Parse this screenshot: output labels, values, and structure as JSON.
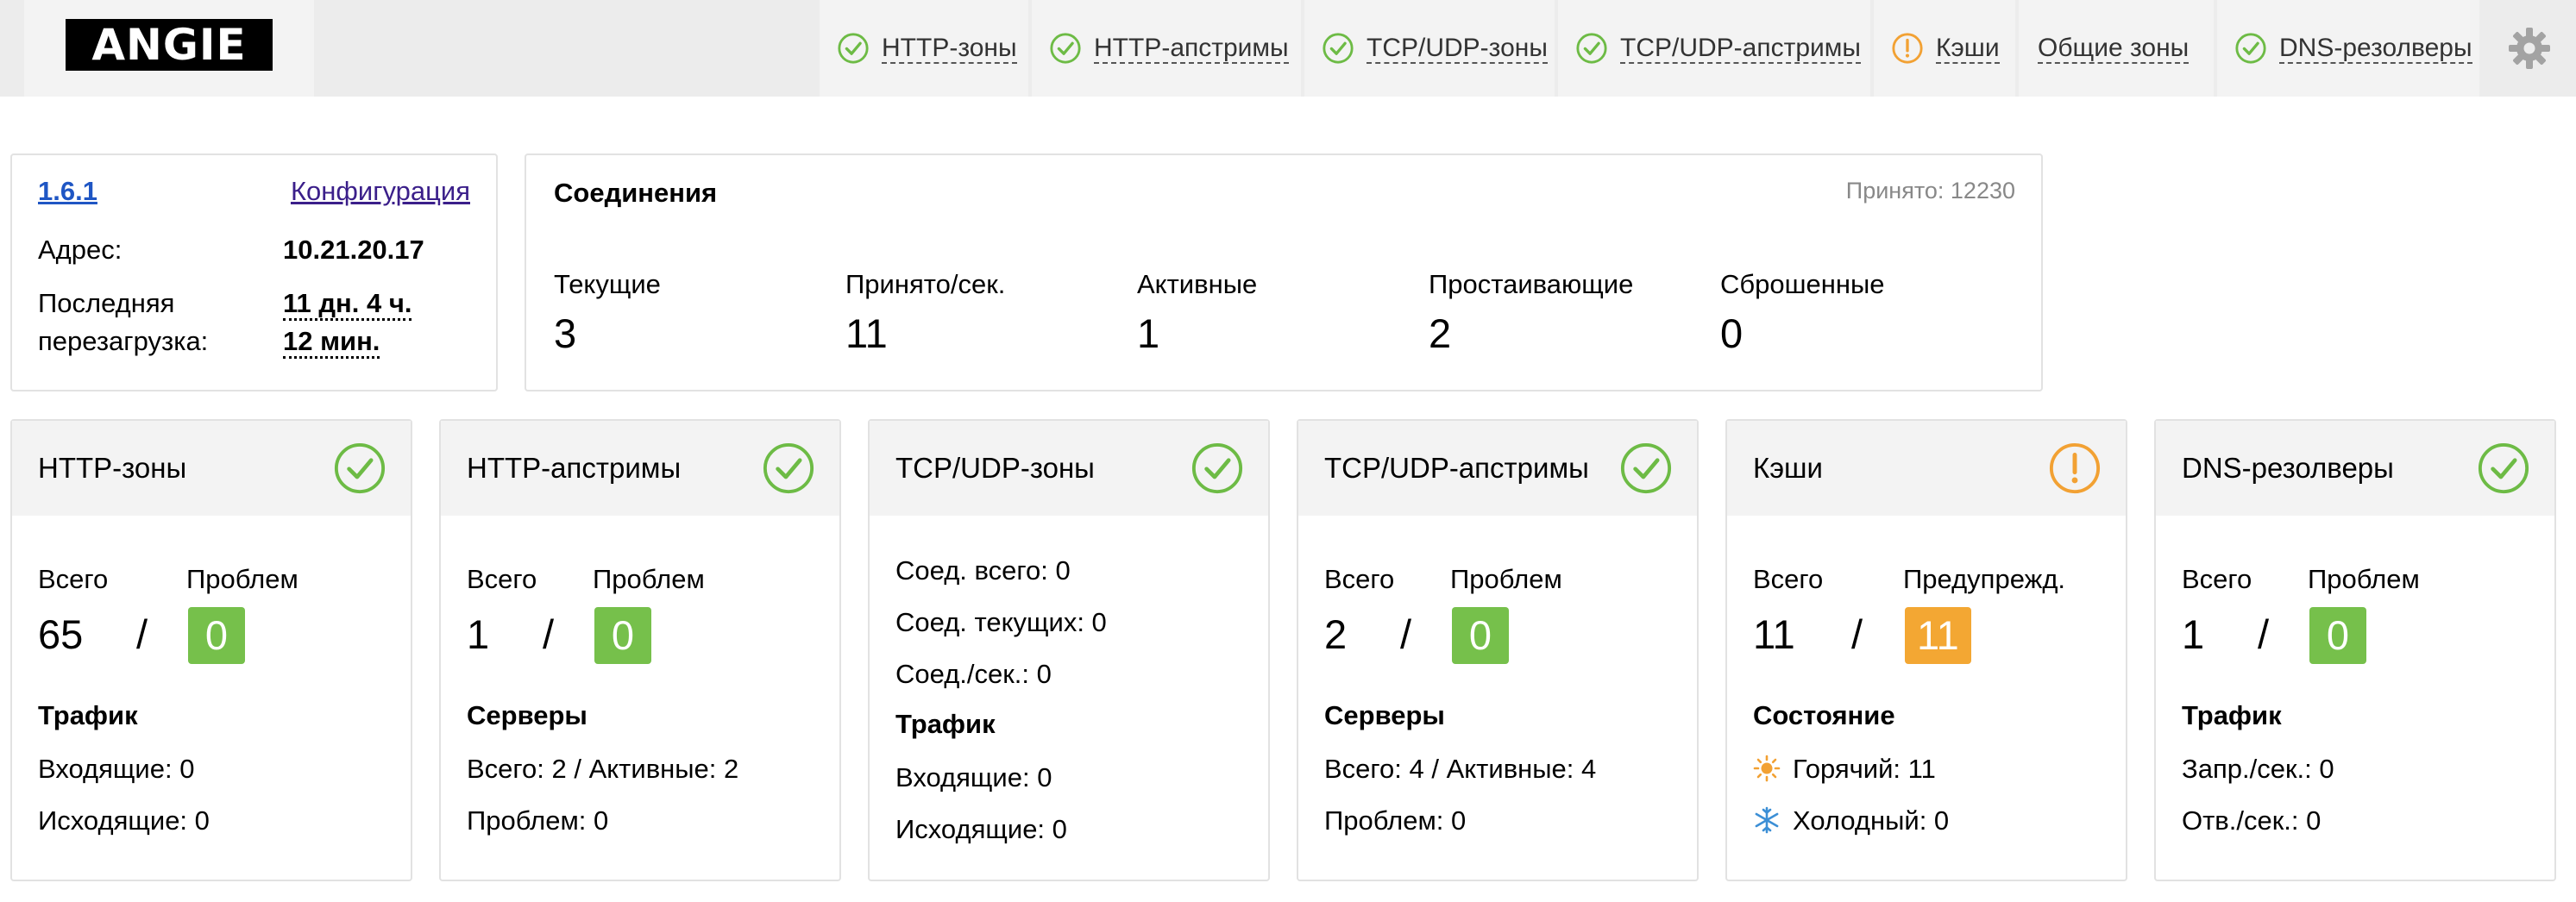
{
  "header": {
    "logo": "ANGIE",
    "tabs": [
      {
        "label": "HTTP-зоны",
        "status": "ok"
      },
      {
        "label": "HTTP-апстримы",
        "status": "ok"
      },
      {
        "label": "TCP/UDP-зоны",
        "status": "ok"
      },
      {
        "label": "TCP/UDP-апстримы",
        "status": "ok"
      },
      {
        "label": "Кэши",
        "status": "warning"
      },
      {
        "label": "Общие зоны",
        "status": "none"
      },
      {
        "label": "DNS-резолверы",
        "status": "ok"
      }
    ]
  },
  "colors": {
    "ok": "#6dbb45",
    "warning": "#f2a133",
    "badge_green": "#76c04b",
    "badge_orange": "#f3a733"
  },
  "info": {
    "version": "1.6.1",
    "config_link": "Конфигурация",
    "address_label": "Адрес:",
    "address": "10.21.20.17",
    "reload_label_1": "Последняя",
    "reload_label_2": "перезагрузка:",
    "reload_value_1": "11 дн. 4 ч.",
    "reload_value_2": "12 мин."
  },
  "connections": {
    "title": "Соединения",
    "accepted_total": "Принято: 12230",
    "items": [
      {
        "label": "Текущие",
        "value": "3"
      },
      {
        "label": "Принято/сек.",
        "value": "11"
      },
      {
        "label": "Активные",
        "value": "1"
      },
      {
        "label": "Простаивающие",
        "value": "2"
      },
      {
        "label": "Сброшенные",
        "value": "0"
      }
    ]
  },
  "cards": {
    "http_zones": {
      "title": "HTTP-зоны",
      "status": "ok",
      "total_label": "Всего",
      "total": "65",
      "sep": "/",
      "problem_label": "Проблем",
      "problem": "0",
      "section": "Трафик",
      "lines": [
        "Входящие: 0",
        "Исходящие: 0"
      ]
    },
    "http_upstreams": {
      "title": "HTTP-апстримы",
      "status": "ok",
      "total_label": "Всего",
      "total": "1",
      "sep": "/",
      "problem_label": "Проблем",
      "problem": "0",
      "section": "Серверы",
      "lines": [
        "Всего: 2 / Активные: 2",
        "Проблем: 0"
      ]
    },
    "tcp_zones": {
      "title": "TCP/UDP-зоны",
      "status": "ok",
      "lines": [
        "Соед. всего: 0",
        "Соед. текущих: 0",
        "Соед./сек.: 0"
      ],
      "section": "Трафик",
      "traffic": [
        "Входящие: 0",
        "Исходящие: 0"
      ]
    },
    "tcp_upstreams": {
      "title": "TCP/UDP-апстримы",
      "status": "ok",
      "total_label": "Всего",
      "total": "2",
      "sep": "/",
      "problem_label": "Проблем",
      "problem": "0",
      "section": "Серверы",
      "lines": [
        "Всего: 4 / Активные: 4",
        "Проблем: 0"
      ]
    },
    "caches": {
      "title": "Кэши",
      "status": "warning",
      "total_label": "Всего",
      "total": "11",
      "sep": "/",
      "problem_label": "Предупрежд.",
      "problem": "11",
      "section": "Состояние",
      "lines": [
        {
          "icon": "sun-icon",
          "text": "Горячий: 11"
        },
        {
          "icon": "snowflake-icon",
          "text": "Холодный: 0"
        }
      ]
    },
    "dns": {
      "title": "DNS-резолверы",
      "status": "ok",
      "total_label": "Всего",
      "total": "1",
      "sep": "/",
      "problem_label": "Проблем",
      "problem": "0",
      "section": "Трафик",
      "lines": [
        "Запр./сек.: 0",
        "Отв./сек.: 0"
      ]
    }
  }
}
